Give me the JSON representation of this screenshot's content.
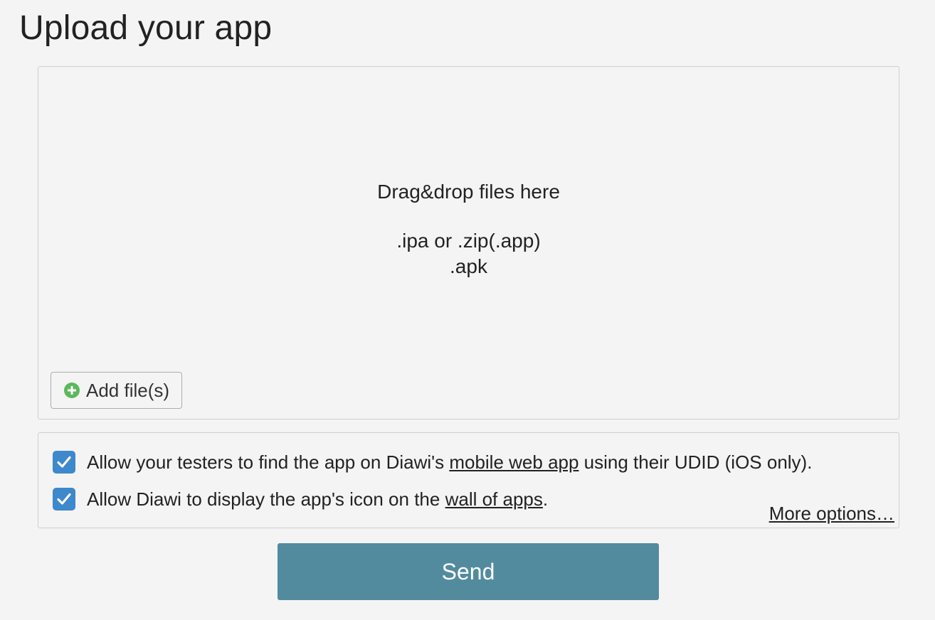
{
  "page": {
    "title": "Upload your app"
  },
  "dropzone": {
    "instruction": "Drag&drop files here",
    "ios_formats": ".ipa or .zip(.app)",
    "android_formats": ".apk",
    "add_files_label": "Add file(s)",
    "add_icon": "plus-circle-icon"
  },
  "options": {
    "udid": {
      "checked": true,
      "text_before": "Allow your testers to find the app on Diawi's ",
      "link_text": "mobile web app",
      "text_after": " using their UDID (iOS only)."
    },
    "wall": {
      "checked": true,
      "text_before": "Allow Diawi to display the app's icon on the ",
      "link_text": "wall of apps",
      "text_after": "."
    },
    "more_options_label": "More options…"
  },
  "send_label": "Send",
  "colors": {
    "background": "#f4f4f4",
    "send_button": "#528b9e",
    "checkbox": "#3e88cc",
    "add_icon": "#5cb85c"
  }
}
